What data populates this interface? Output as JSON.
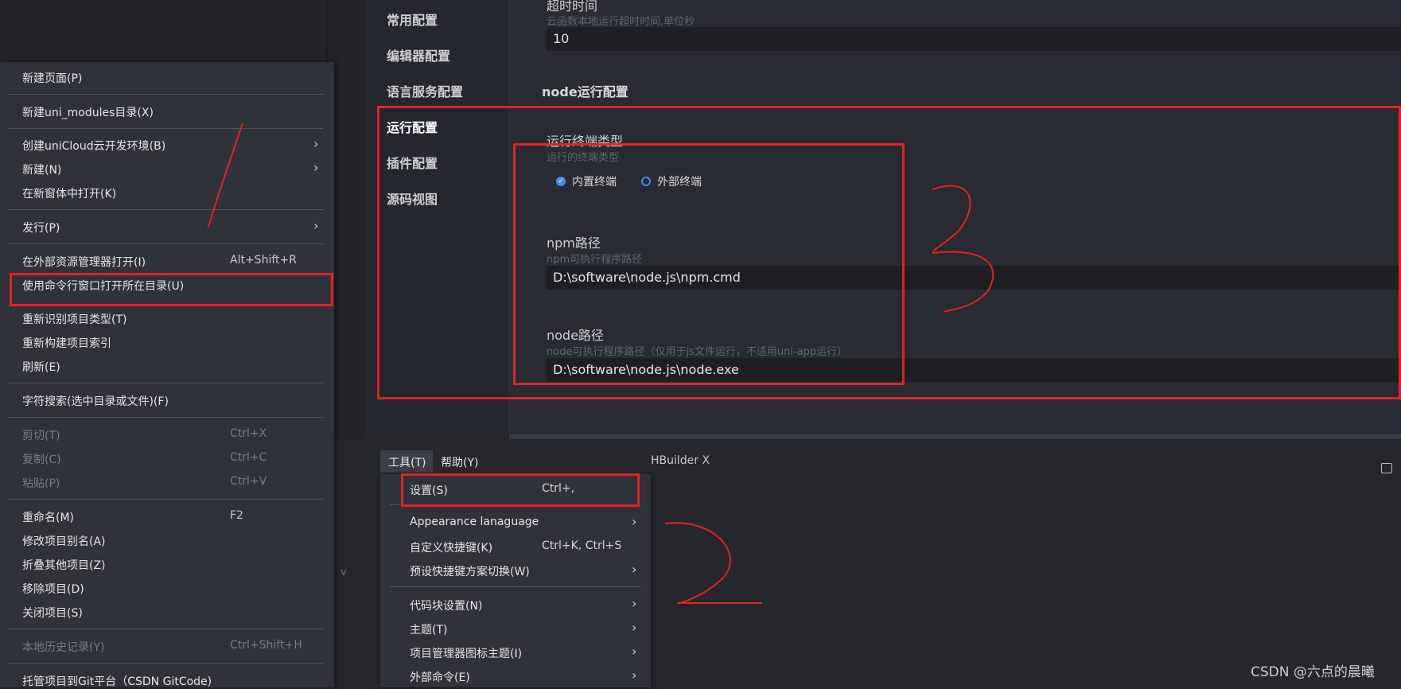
{
  "settings": {
    "nav": [
      "常用配置",
      "编辑器配置",
      "语言服务配置",
      "运行配置",
      "插件配置",
      "源码视图"
    ],
    "active_nav": "运行配置",
    "timeout_label": "超时时间",
    "timeout_sub": "云函数本地运行超时时间,单位秒",
    "timeout_value": "10",
    "section_title": "node运行配置",
    "terminal_label": "运行终端类型",
    "terminal_sub": "运行的终端类型",
    "terminal_options": [
      "内置终端",
      "外部终端"
    ],
    "npm_label": "npm路径",
    "npm_sub": "npm可执行程序路径",
    "npm_value": "D:\\software\\node.js\\npm.cmd",
    "node_label": "node路径",
    "node_sub": "node可执行程序路径（仅用于js文件运行，不适用uni-app运行）",
    "node_value": "D:\\software\\node.js\\node.exe"
  },
  "context_menu": {
    "items": [
      {
        "label": "新建页面(P)"
      },
      {
        "label": "新建uni_modules目录(X)"
      },
      {
        "label": "创建uniCloud云开发环境(B)",
        "submenu": true
      },
      {
        "label": "新建(N)",
        "submenu": true
      },
      {
        "label": "在新窗体中打开(K)"
      },
      {
        "label": "发行(P)",
        "submenu": true
      },
      {
        "label": "在外部资源管理器打开(I)",
        "shortcut": "Alt+Shift+R"
      },
      {
        "label": "使用命令行窗口打开所在目录(U)"
      },
      {
        "label": "重新识别项目类型(T)"
      },
      {
        "label": "重新构建项目索引"
      },
      {
        "label": "刷新(E)"
      },
      {
        "label": "字符搜索(选中目录或文件)(F)"
      },
      {
        "label": "剪切(T)",
        "shortcut": "Ctrl+X",
        "disabled": true
      },
      {
        "label": "复制(C)",
        "shortcut": "Ctrl+C",
        "disabled": true
      },
      {
        "label": "粘贴(P)",
        "shortcut": "Ctrl+V",
        "disabled": true
      },
      {
        "label": "重命名(M)",
        "shortcut": "F2"
      },
      {
        "label": "修改项目别名(A)"
      },
      {
        "label": "折叠其他项目(Z)"
      },
      {
        "label": "移除项目(D)"
      },
      {
        "label": "关闭项目(S)"
      },
      {
        "label": "本地历史记录(Y)",
        "shortcut": "Ctrl+Shift+H",
        "disabled": true
      },
      {
        "label": "托管项目到Git平台（CSDN GitCode)"
      }
    ]
  },
  "menubar": {
    "tools": "工具(T)",
    "help": "帮助(Y)",
    "app": "HBuilder X"
  },
  "tools_menu": {
    "items": [
      {
        "label": "设置(S)",
        "shortcut": "Ctrl+,"
      },
      {
        "label": "Appearance lanaguage",
        "submenu": true
      },
      {
        "label": "自定义快捷键(K)",
        "shortcut": "Ctrl+K, Ctrl+S"
      },
      {
        "label": "预设快捷键方案切换(W)",
        "submenu": true
      },
      {
        "label": "代码块设置(N)",
        "submenu": true
      },
      {
        "label": "主题(T)",
        "submenu": true
      },
      {
        "label": "项目管理器图标主题(I)",
        "submenu": true
      },
      {
        "label": "外部命令(E)",
        "submenu": true
      }
    ]
  },
  "annotations": {
    "color": "#e0222a",
    "numbers": [
      "1",
      "2",
      "3"
    ]
  },
  "watermark": "CSDN @六点的晨曦",
  "stray_char": "v",
  "colors": {
    "accent": "#3d8fe8",
    "annotation": "#e0222a"
  }
}
